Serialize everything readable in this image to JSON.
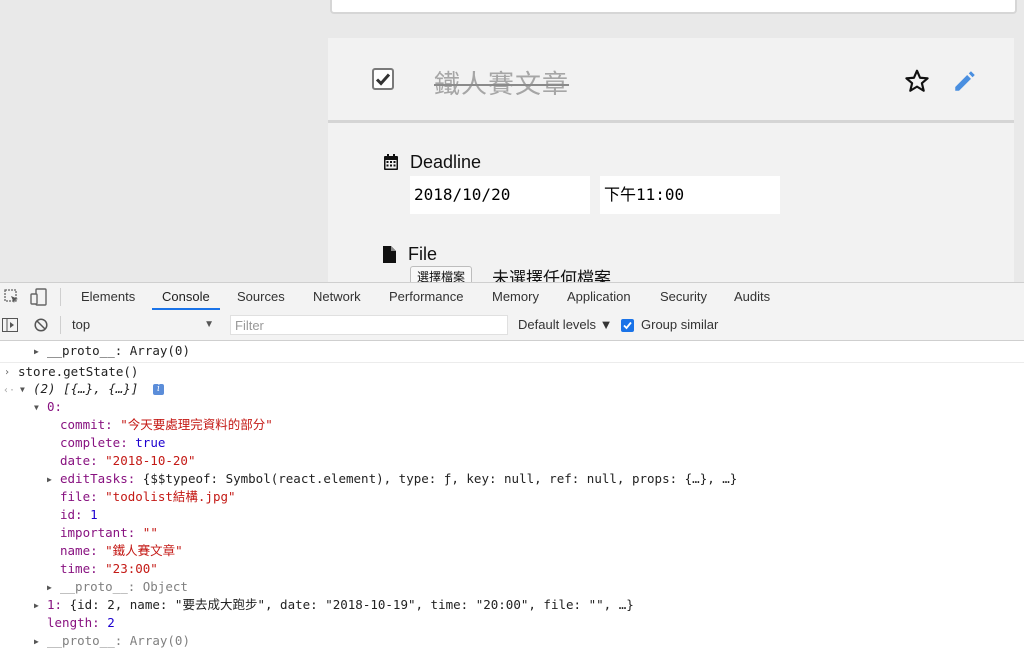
{
  "task": {
    "title": "鐵人賽文章",
    "deadline_label": "Deadline",
    "date_value": "2018/10/20",
    "time_value": "下午11:00",
    "file_label": "File",
    "file_button": "選擇檔案",
    "file_none": "未選擇任何檔案",
    "accent_color": "#4a8fe0"
  },
  "devtools": {
    "tabs": [
      "Elements",
      "Console",
      "Sources",
      "Network",
      "Performance",
      "Memory",
      "Application",
      "Security",
      "Audits"
    ],
    "active_tab": "Console",
    "context": "top",
    "filter_placeholder": "Filter",
    "levels": "Default levels ▼",
    "group_similar": "Group similar"
  },
  "console": {
    "proto_top": "__proto__: Array(0)",
    "command": "store.getState()",
    "result_summary": "(2) [{…}, {…}]",
    "item0_label": "0:",
    "commit_key": "commit: ",
    "commit_value": "\"今天要處理完資料的部分\"",
    "complete_key": "complete: ",
    "complete_value": "true",
    "date_key": "date: ",
    "date_value": "\"2018-10-20\"",
    "edit_key": "editTasks: ",
    "edit_value": "{$$typeof: Symbol(react.element), type: ƒ, key: null, ref: null, props: {…}, …}",
    "file_key": "file: ",
    "file_value": "\"todolist結構.jpg\"",
    "id_key": "id: ",
    "id_value": "1",
    "important_key": "important: ",
    "important_value": "\"\"",
    "name_key": "name: ",
    "name_value": "\"鐵人賽文章\"",
    "time_key": "time: ",
    "time_value": "\"23:00\"",
    "proto_obj": "__proto__: Object",
    "item1_key": "1: ",
    "item1_value": "{id: 2, name: \"要去成大跑步\", date: \"2018-10-19\", time: \"20:00\", file: \"\", …}",
    "length_key": "length: ",
    "length_value": "2",
    "proto_arr": "__proto__: Array(0)"
  }
}
